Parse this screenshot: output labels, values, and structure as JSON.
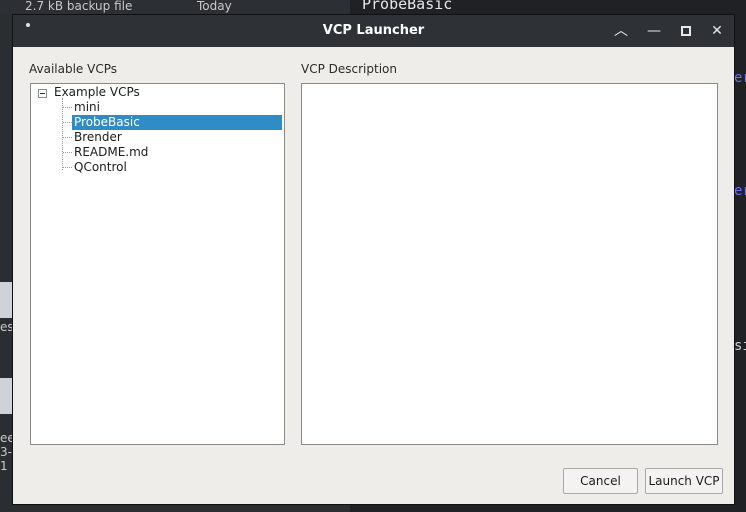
{
  "background": {
    "file_size": "2.7 kB  backup file",
    "file_date": "Today",
    "terminal_text": "ProbeBasic",
    "left_fragments": [
      "es",
      "ee",
      "3-1"
    ],
    "right_fragment_1": "er",
    "right_fragment_2": "er",
    "right_fragment_3": "si"
  },
  "dialog": {
    "title": "VCP Launcher",
    "titlebar_icons": [
      "menu-dot-icon",
      "maximize-chevron-icon",
      "minimize-icon",
      "restore-icon",
      "close-icon"
    ],
    "titlebar_glyphs": {
      "up": "︿",
      "min": "—",
      "restore": "▫",
      "close": "✕"
    },
    "left_label": "Available VCPs",
    "right_label": "VCP Description",
    "tree": {
      "root": "Example VCPs",
      "items": [
        "mini",
        "ProbeBasic",
        "Brender",
        "README.md",
        "QControl"
      ],
      "selected": "ProbeBasic"
    },
    "description_text": "",
    "buttons": {
      "cancel": "Cancel",
      "launch": "Launch VCP"
    },
    "colors": {
      "selection": "#308cc6",
      "titlebar": "#2e3236"
    }
  }
}
